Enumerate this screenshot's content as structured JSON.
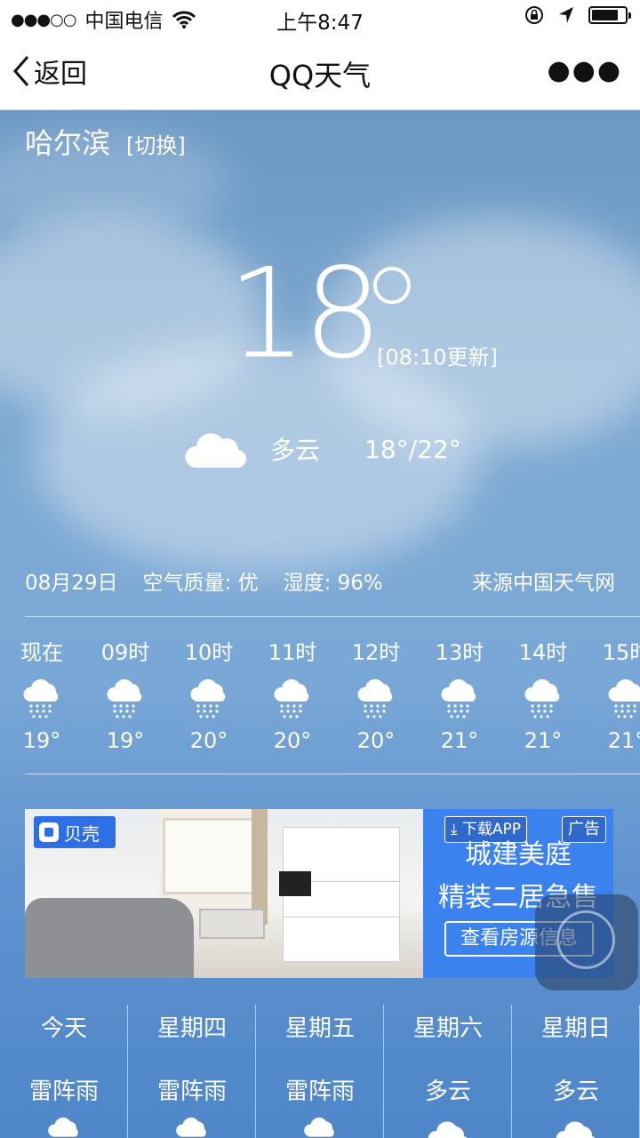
{
  "status_bar": {
    "carrier": "中国电信",
    "signal_dots": "●●●○○",
    "time": "上午8:47",
    "battery_level": 0.8,
    "icons": [
      "signal-icon",
      "wifi-icon",
      "rotation-lock-icon",
      "location-arrow-icon",
      "battery-icon"
    ]
  },
  "nav": {
    "back_label": "返回",
    "title": "QQ天气",
    "more_icon": "more-icon"
  },
  "weather": {
    "city": "哈尔滨",
    "switch_label": "[切换]",
    "current_temp": "18",
    "update_text": "[08:10更新]",
    "condition": "多云",
    "range": "18°/22°",
    "date": "08月29日",
    "air_quality": "空气质量: 优",
    "humidity": "湿度: 96%",
    "source": "来源中国天气网"
  },
  "hourly": [
    {
      "label": "现在",
      "temp": "19°",
      "icon": "rain-cloud-icon"
    },
    {
      "label": "09时",
      "temp": "19°",
      "icon": "rain-cloud-icon"
    },
    {
      "label": "10时",
      "temp": "20°",
      "icon": "rain-cloud-icon"
    },
    {
      "label": "11时",
      "temp": "20°",
      "icon": "rain-cloud-icon"
    },
    {
      "label": "12时",
      "temp": "20°",
      "icon": "rain-cloud-icon"
    },
    {
      "label": "13时",
      "temp": "21°",
      "icon": "rain-cloud-icon"
    },
    {
      "label": "14时",
      "temp": "21°",
      "icon": "rain-cloud-icon"
    },
    {
      "label": "15时",
      "temp": "21°",
      "icon": "rain-cloud-icon"
    }
  ],
  "ad": {
    "brand": "贝壳",
    "download": "下载APP",
    "tag": "广告",
    "headline1": "城建美庭",
    "headline2": "精装二居急售",
    "button": "查看房源信息"
  },
  "daily": [
    {
      "label": "今天",
      "cond": "雷阵雨",
      "icon": "rain-cloud-icon"
    },
    {
      "label": "星期四",
      "cond": "雷阵雨",
      "icon": "rain-cloud-icon"
    },
    {
      "label": "星期五",
      "cond": "雷阵雨",
      "icon": "rain-cloud-icon"
    },
    {
      "label": "星期六",
      "cond": "多云",
      "icon": "cloud-icon"
    },
    {
      "label": "星期日",
      "cond": "多云",
      "icon": "cloud-icon"
    }
  ],
  "colors": {
    "sky_top": "#6b98c4",
    "sky_bottom": "#4e86c9",
    "ad_blue": "#3b82ef",
    "brand_blue": "#2e6fe6"
  }
}
